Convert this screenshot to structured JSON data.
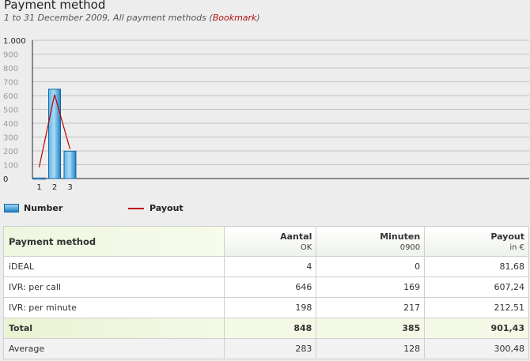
{
  "header": {
    "title": "Payment method",
    "subtitle_prefix": "1 to 31 December 2009, All payment methods (",
    "bookmark_label": "Bookmark",
    "subtitle_suffix": ")"
  },
  "chart_data": {
    "type": "bar",
    "categories": [
      "1",
      "2",
      "3"
    ],
    "series": [
      {
        "name": "Number",
        "type": "bar",
        "values": [
          4,
          646,
          198
        ],
        "color": "#2a8fd0"
      },
      {
        "name": "Payout",
        "type": "line",
        "values": [
          81.68,
          607.24,
          212.51
        ],
        "color": "#c00000"
      }
    ],
    "y_ticks": [
      "1.000",
      "900",
      "800",
      "700",
      "600",
      "500",
      "400",
      "300",
      "200",
      "100",
      "0"
    ],
    "ylim": [
      0,
      1000
    ],
    "grid": true,
    "legend": "bottom-left"
  },
  "legend": {
    "number_label": "Number",
    "payout_label": "Payout"
  },
  "table": {
    "col1": "Payment method",
    "col2": "Aantal",
    "col2_sub": "OK",
    "col3": "Minuten",
    "col3_sub": "0900",
    "col4": "Payout",
    "col4_sub": "in €",
    "rows": [
      {
        "method": "iDEAL",
        "count": "4",
        "minutes": "0",
        "payout": "81,68"
      },
      {
        "method": "IVR: per call",
        "count": "646",
        "minutes": "169",
        "payout": "607,24"
      },
      {
        "method": "IVR: per minute",
        "count": "198",
        "minutes": "217",
        "payout": "212,51"
      }
    ],
    "total": {
      "label": "Total",
      "count": "848",
      "minutes": "385",
      "payout": "901,43"
    },
    "average": {
      "label": "Average",
      "count": "283",
      "minutes": "128",
      "payout": "300,48"
    }
  },
  "colors": {
    "bar_fill": "#2a8fd0",
    "line": "#c00000",
    "bookmark": "#b01010"
  }
}
